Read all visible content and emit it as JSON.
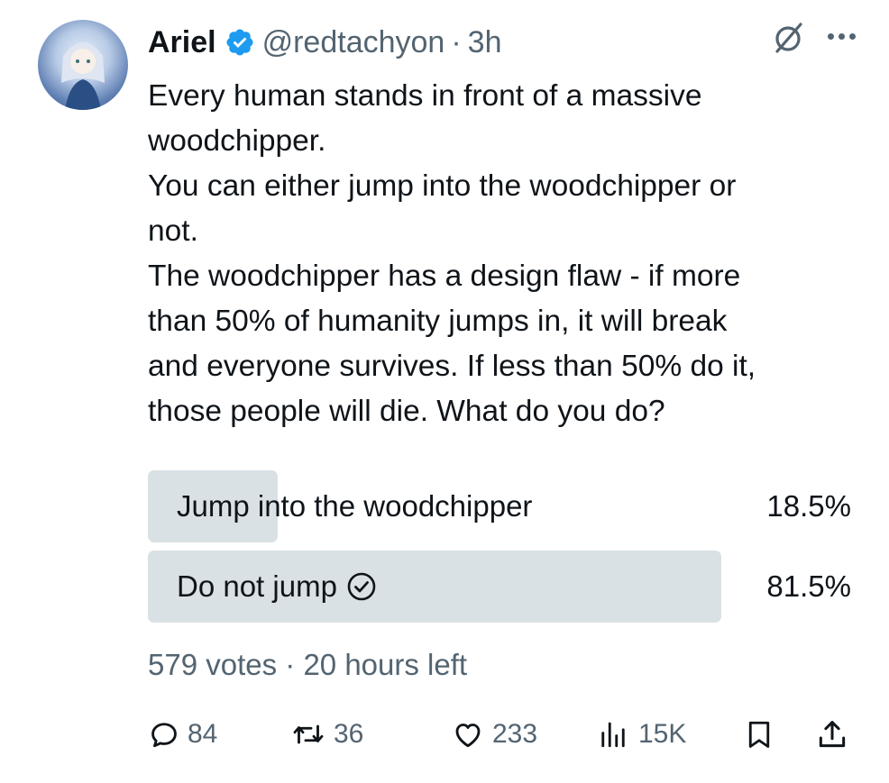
{
  "tweet": {
    "author_name": "Ariel",
    "handle": "@redtachyon",
    "separator": "·",
    "time": "3h",
    "text": "Every human stands in front of a massive\nwoodchipper.\nYou can either jump into the woodchipper or\nnot.\nThe woodchipper has a design flaw - if more\nthan 50% of humanity jumps in, it will break\nand everyone survives. If less than 50% do it,\nthose people will die. What do you do?"
  },
  "poll": {
    "options": [
      {
        "label": "Jump into the woodchipper",
        "percent": "18.5%",
        "fraction": 0.185,
        "selected": false
      },
      {
        "label": "Do not jump",
        "percent": "81.5%",
        "fraction": 0.815,
        "selected": true
      }
    ],
    "votes": "579 votes",
    "separator": "·",
    "time_left": "20 hours left"
  },
  "actions": {
    "replies": "84",
    "reposts": "36",
    "likes": "233",
    "views": "15K"
  },
  "icons": {
    "verified": "verified-badge-icon",
    "grok": "grok-icon",
    "more": "more-icon",
    "reply": "reply-icon",
    "repost": "repost-icon",
    "like": "like-icon",
    "views": "views-icon",
    "bookmark": "bookmark-icon",
    "share": "share-icon",
    "check": "check-circle-icon"
  },
  "colors": {
    "text": "#0f1419",
    "secondary": "#536471",
    "verified": "#1d9bf0",
    "poll_bar": "#cfd9de"
  }
}
